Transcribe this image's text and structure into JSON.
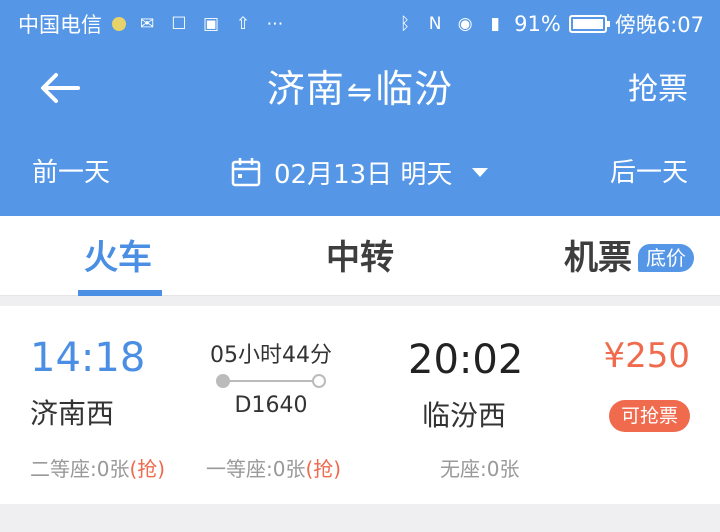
{
  "status_bar": {
    "carrier": "中国电信",
    "battery": "91%",
    "time": "傍晚6:07"
  },
  "header": {
    "from": "济南",
    "to": "临汾",
    "swap_symbol": "⇋",
    "grab_label": "抢票",
    "prev_day": "前一天",
    "next_day": "后一天",
    "date": "02月13日 明天"
  },
  "tabs": [
    {
      "label": "火车",
      "active": true
    },
    {
      "label": "中转",
      "active": false
    },
    {
      "label": "机票",
      "active": false,
      "badge": "底价"
    }
  ],
  "train": {
    "dep_time": "14:18",
    "dep_station": "济南西",
    "duration": "05小时44分",
    "train_no": "D1640",
    "arr_time": "20:02",
    "arr_station": "临汾西",
    "price": "¥250",
    "tag": "可抢票",
    "seats": [
      {
        "label": "二等座:0张",
        "grab": "(抢)"
      },
      {
        "label": "一等座:0张",
        "grab": "(抢)"
      },
      {
        "label": "无座:0张",
        "grab": ""
      }
    ]
  },
  "colors": {
    "header_bg": "#5597e6",
    "accent": "#4a8fe3",
    "price": "#f06a4e"
  }
}
